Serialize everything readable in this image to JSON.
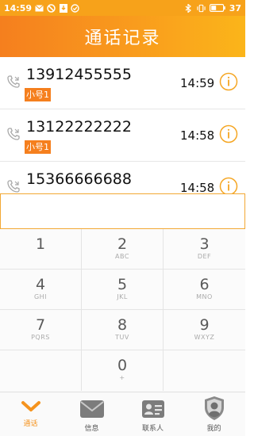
{
  "status_bar": {
    "time": "14:59",
    "battery": "37",
    "icons": [
      "mail-icon",
      "block-icon",
      "download-icon",
      "check-circle-icon",
      "bluetooth-icon",
      "vibrate-icon",
      "battery-icon"
    ]
  },
  "header": {
    "title": "通话记录"
  },
  "calls": [
    {
      "number": "13912455555",
      "tag": "小号1",
      "time": "14:59"
    },
    {
      "number": "13122222222",
      "tag": "小号1",
      "time": "14:58"
    },
    {
      "number": "15366666688",
      "tag": "",
      "time": "14:58"
    }
  ],
  "dial_input": {
    "value": ""
  },
  "keypad": [
    {
      "digit": "1",
      "letters": ""
    },
    {
      "digit": "2",
      "letters": "ABC"
    },
    {
      "digit": "3",
      "letters": "DEF"
    },
    {
      "digit": "4",
      "letters": "GHI"
    },
    {
      "digit": "5",
      "letters": "JKL"
    },
    {
      "digit": "6",
      "letters": "MNO"
    },
    {
      "digit": "7",
      "letters": "PQRS"
    },
    {
      "digit": "8",
      "letters": "TUV"
    },
    {
      "digit": "9",
      "letters": "WXYZ"
    },
    {
      "digit": "",
      "letters": ""
    },
    {
      "digit": "0",
      "letters": "+"
    },
    {
      "digit": "",
      "letters": ""
    }
  ],
  "tabs": [
    {
      "label": "通话",
      "icon": "chevron-down-icon",
      "active": true
    },
    {
      "label": "信息",
      "icon": "envelope-icon",
      "active": false
    },
    {
      "label": "联系人",
      "icon": "contact-card-icon",
      "active": false
    },
    {
      "label": "我的",
      "icon": "shield-avatar-icon",
      "active": false
    }
  ],
  "colors": {
    "accent": "#f5931e",
    "tag": "#f57f1e",
    "header_start": "#f57f1e",
    "header_end": "#fbb51a"
  }
}
